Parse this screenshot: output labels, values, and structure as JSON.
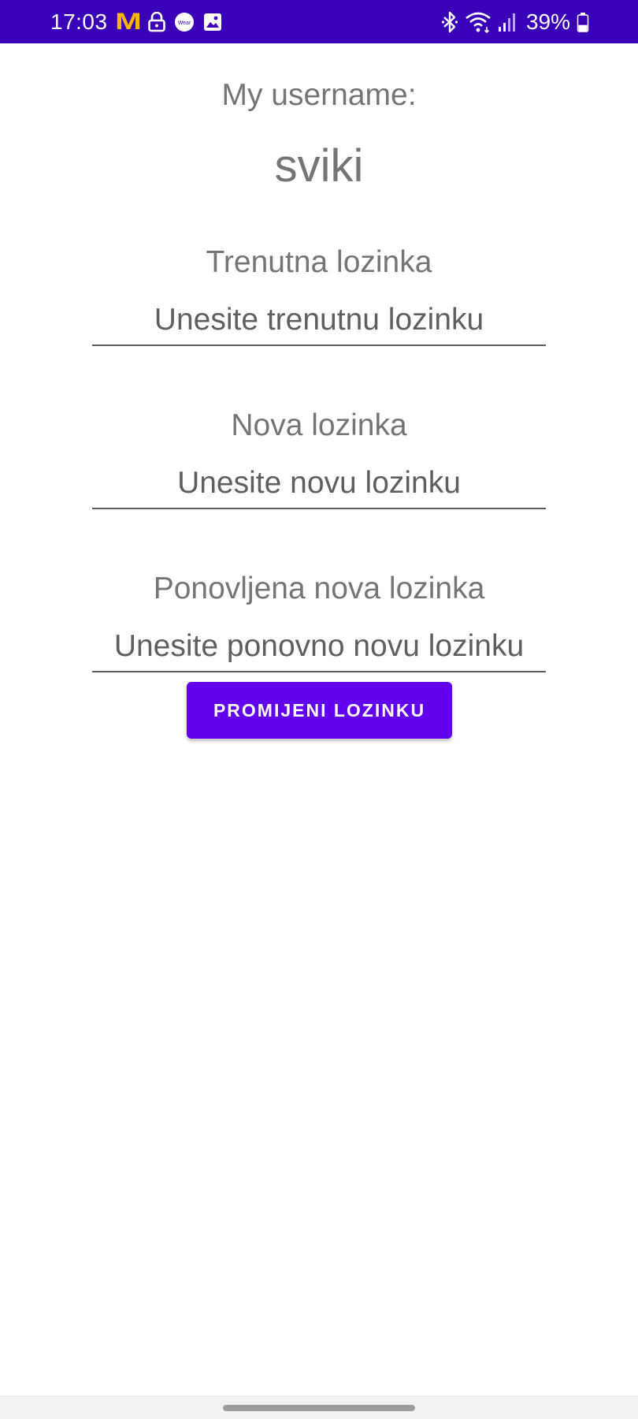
{
  "status_bar": {
    "time": "17:03",
    "battery_percent": "39%",
    "background_color": "#3a00b7",
    "left_icons": [
      "mcdonalds-icon",
      "lock-icon",
      "wear-icon",
      "gallery-icon"
    ],
    "right_icons": [
      "bluetooth-icon",
      "wifi-icon",
      "signal-icon",
      "battery-icon"
    ],
    "wear_icon_text": "Wear",
    "battery_level": 0.39
  },
  "profile": {
    "username_label": "My username:",
    "username_value": "sviki"
  },
  "fields": {
    "current_password": {
      "label": "Trenutna lozinka",
      "placeholder": "Unesite trenutnu lozinku",
      "value": ""
    },
    "new_password": {
      "label": "Nova lozinka",
      "placeholder": "Unesite novu lozinku",
      "value": ""
    },
    "repeat_password": {
      "label": "Ponovljena nova lozinka",
      "placeholder": "Unesite ponovno novu lozinku",
      "value": ""
    }
  },
  "actions": {
    "change_password_label": "PROMIJENI LOZINKU",
    "button_color": "#6200ee"
  }
}
